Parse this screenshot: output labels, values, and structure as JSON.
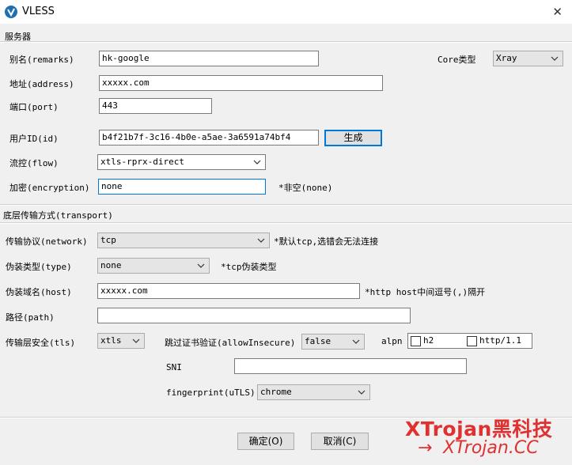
{
  "window": {
    "title": "VLESS",
    "close_glyph": "✕"
  },
  "server": {
    "section_title": "服务器",
    "remarks_label": "别名(remarks)",
    "remarks_value": "hk-google",
    "core_label": "Core类型",
    "core_value": "Xray",
    "address_label": "地址(address)",
    "address_value": "xxxxx.com",
    "port_label": "端口(port)",
    "port_value": "443",
    "id_label": "用户ID(id)",
    "id_value": "b4f21b7f-3c16-4b0e-a5ae-3a6591a74bf4",
    "generate_button": "生成",
    "flow_label": "流控(flow)",
    "flow_value": "xtls-rprx-direct",
    "encryption_label": "加密(encryption)",
    "encryption_value": "none",
    "encryption_hint": "*非空(none)"
  },
  "transport": {
    "section_title": "底层传输方式(transport)",
    "network_label": "传输协议(network)",
    "network_value": "tcp",
    "network_hint": "*默认tcp,选错会无法连接",
    "type_label": "伪装类型(type)",
    "type_value": "none",
    "type_hint": "*tcp伪装类型",
    "host_label": "伪装域名(host)",
    "host_value": "xxxxx.com",
    "host_hint": "*http host中间逗号(,)隔开",
    "path_label": "路径(path)",
    "path_value": "",
    "tls_label": "传输层安全(tls)",
    "tls_value": "xtls",
    "insecure_label": "跳过证书验证(allowInsecure)",
    "insecure_value": "false",
    "alpn_label": "alpn",
    "alpn_h2": "h2",
    "alpn_http11": "http/1.1",
    "sni_label": "SNI",
    "sni_value": "",
    "fingerprint_label": "fingerprint(uTLS)",
    "fingerprint_value": "chrome"
  },
  "footer": {
    "ok_button": "确定(O)",
    "cancel_button": "取消(C)"
  },
  "watermark": {
    "line1": "XTrojan黑科技",
    "line2": "XTrojan.CC",
    "arrow": "→"
  },
  "colors": {
    "accent": "#0078d7",
    "watermark": "#e03030",
    "app_icon": "#1f6fb2"
  },
  "icons": {
    "app": "v2ray-logo-icon",
    "dropdown": "chevron-down-icon"
  }
}
